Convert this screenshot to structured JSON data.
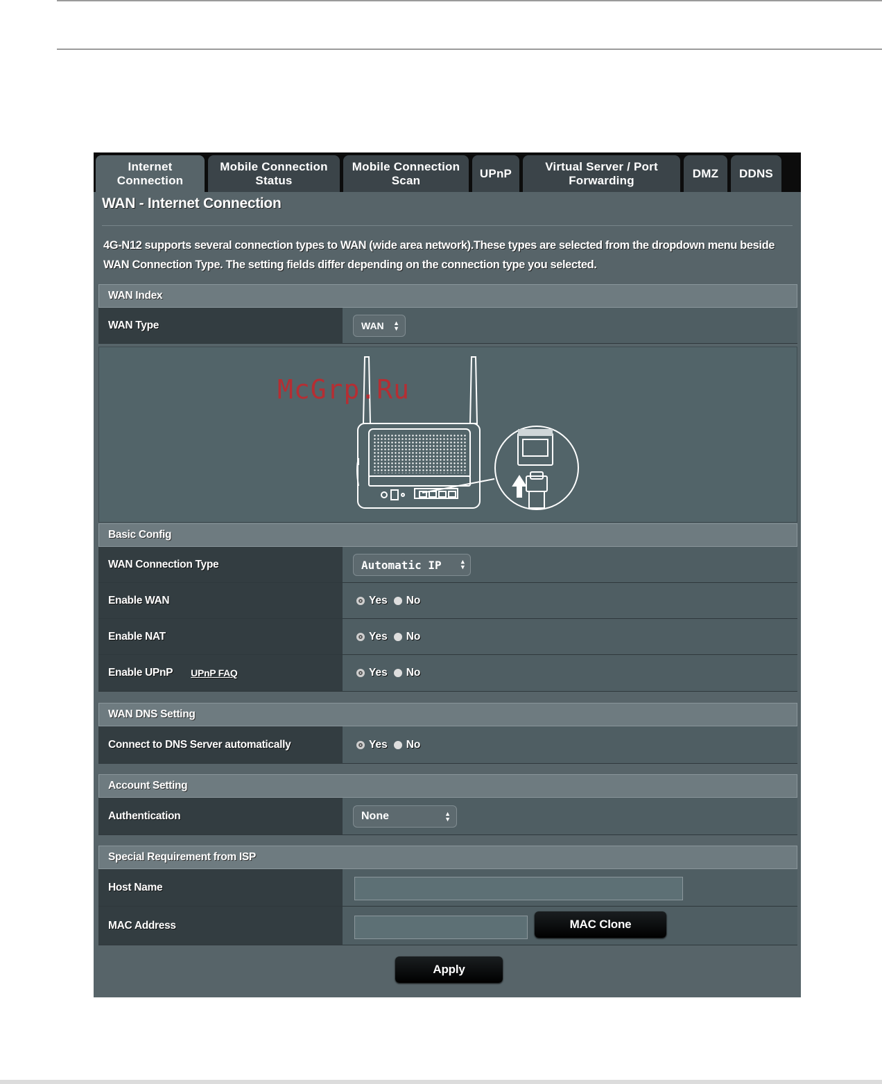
{
  "tabs": [
    {
      "label": "Internet\nConnection"
    },
    {
      "label": "Mobile Connection\nStatus"
    },
    {
      "label": "Mobile Connection\nScan"
    },
    {
      "label": "UPnP"
    },
    {
      "label": "Virtual Server / Port\nForwarding"
    },
    {
      "label": "DMZ"
    },
    {
      "label": "DDNS"
    }
  ],
  "page_title": "WAN - Internet Connection",
  "description": "4G-N12 supports several connection types to WAN (wide area network).These types are selected from the dropdown menu beside WAN Connection Type. The setting fields differ depending on the connection type you selected.",
  "wan_index": {
    "header": "WAN Index",
    "wan_type_label": "WAN Type",
    "wan_type_value": "WAN"
  },
  "basic_config": {
    "header": "Basic Config",
    "conn_type_label": "WAN Connection Type",
    "conn_type_value": "Automatic IP",
    "enable_wan_label": "Enable WAN",
    "enable_nat_label": "Enable NAT",
    "enable_upnp_label": "Enable UPnP",
    "upnp_faq": "UPnP  FAQ"
  },
  "radio": {
    "yes": "Yes",
    "no": "No"
  },
  "dns": {
    "header": "WAN DNS Setting",
    "auto_label": "Connect to DNS Server automatically"
  },
  "account": {
    "header": "Account Setting",
    "auth_label": "Authentication",
    "auth_value": "None"
  },
  "isp": {
    "header": "Special Requirement from ISP",
    "host_label": "Host Name",
    "host_value": "",
    "mac_label": "MAC Address",
    "mac_value": "",
    "mac_clone": "MAC Clone"
  },
  "apply": "Apply",
  "watermark": "McGrp.Ru",
  "icons": {
    "select_arrows": "updown-arrows-icon",
    "router": "router-diagram-icon"
  }
}
